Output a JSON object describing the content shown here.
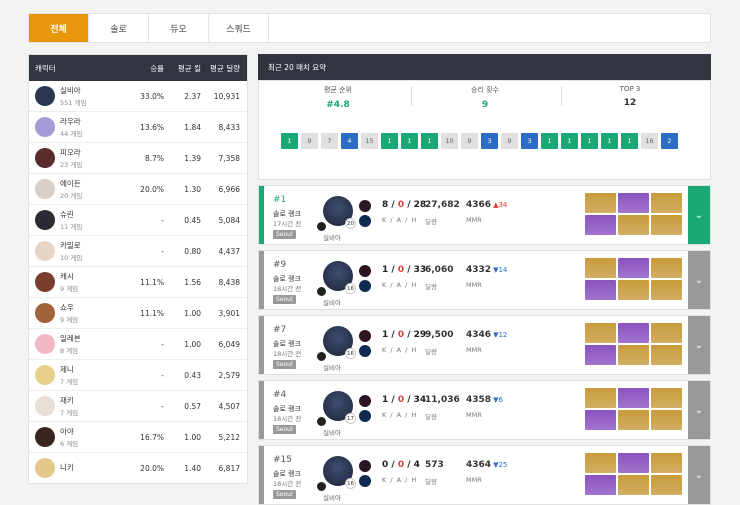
{
  "tabs": [
    {
      "label": "전체"
    },
    {
      "label": "솔로"
    },
    {
      "label": "듀오"
    },
    {
      "label": "스쿼드"
    }
  ],
  "table": {
    "headers": {
      "character": "캐릭터",
      "winrate": "승률",
      "avg_kill": "평균 킬",
      "avg_damage": "평균 딜량"
    },
    "rows": [
      {
        "name": "실비아",
        "games": "551 게임",
        "winrate": "33.0%",
        "kill": "2.37",
        "damage": "10,931",
        "color": "#2a3550"
      },
      {
        "name": "라우라",
        "games": "44 게임",
        "winrate": "13.6%",
        "kill": "1.84",
        "damage": "8,433",
        "color": "#a79ad8"
      },
      {
        "name": "피오라",
        "games": "23 게임",
        "winrate": "8.7%",
        "kill": "1.39",
        "damage": "7,358",
        "color": "#5a2b2b"
      },
      {
        "name": "에이든",
        "games": "20 게임",
        "winrate": "20.0%",
        "kill": "1.30",
        "damage": "6,966",
        "color": "#d7cfc8"
      },
      {
        "name": "슈린",
        "games": "11 게임",
        "winrate": "-",
        "kill": "0.45",
        "damage": "5,084",
        "color": "#2b2b33"
      },
      {
        "name": "카밀로",
        "games": "10 게임",
        "winrate": "-",
        "kill": "0.80",
        "damage": "4,437",
        "color": "#e6d5c3"
      },
      {
        "name": "캐시",
        "games": "9 게임",
        "winrate": "11.1%",
        "kill": "1.56",
        "damage": "8,438",
        "color": "#7a3e2c"
      },
      {
        "name": "쇼우",
        "games": "9 게임",
        "winrate": "11.1%",
        "kill": "1.00",
        "damage": "3,901",
        "color": "#a0633a"
      },
      {
        "name": "일레븐",
        "games": "8 게임",
        "winrate": "-",
        "kill": "1.00",
        "damage": "6,049",
        "color": "#f1b8c4"
      },
      {
        "name": "제니",
        "games": "7 게임",
        "winrate": "-",
        "kill": "0.43",
        "damage": "2,579",
        "color": "#e6d08a"
      },
      {
        "name": "재키",
        "games": "7 게임",
        "winrate": "-",
        "kill": "0.57",
        "damage": "4,507",
        "color": "#e8e0d6"
      },
      {
        "name": "아야",
        "games": "6 게임",
        "winrate": "16.7%",
        "kill": "1.00",
        "damage": "5,212",
        "color": "#3b2420"
      },
      {
        "name": "니키",
        "games": "",
        "winrate": "20.0%",
        "kill": "1.40",
        "damage": "6,817",
        "color": "#e6c78a"
      }
    ]
  },
  "summary": {
    "title": "최근 20 매치 요약",
    "avg_rank_label": "평균 순위",
    "avg_rank": "#4.8",
    "wins_label": "승리 횟수",
    "wins": "9",
    "top3_label": "TOP 3",
    "top3": "12",
    "chips": [
      {
        "v": "1",
        "c": "#1aa874"
      },
      {
        "v": "9",
        "c": "#e0e0e0"
      },
      {
        "v": "7",
        "c": "#e0e0e0"
      },
      {
        "v": "4",
        "c": "#2b6cc4"
      },
      {
        "v": "15",
        "c": "#e0e0e0"
      },
      {
        "v": "1",
        "c": "#1aa874"
      },
      {
        "v": "1",
        "c": "#1aa874"
      },
      {
        "v": "1",
        "c": "#1aa874"
      },
      {
        "v": "10",
        "c": "#e0e0e0"
      },
      {
        "v": "9",
        "c": "#e0e0e0"
      },
      {
        "v": "3",
        "c": "#2b6cc4"
      },
      {
        "v": "9",
        "c": "#e0e0e0"
      },
      {
        "v": "3",
        "c": "#2b6cc4"
      },
      {
        "v": "1",
        "c": "#1aa874"
      },
      {
        "v": "1",
        "c": "#1aa874"
      },
      {
        "v": "1",
        "c": "#1aa874"
      },
      {
        "v": "1",
        "c": "#1aa874"
      },
      {
        "v": "1",
        "c": "#1aa874"
      },
      {
        "v": "16",
        "c": "#e0e0e0"
      },
      {
        "v": "2",
        "c": "#2b6cc4"
      }
    ]
  },
  "matches": [
    {
      "rank": "#1",
      "mode": "솔로 랭크",
      "time": "17시간 전",
      "region": "Seoul",
      "char": "실비아",
      "level": "20",
      "k": "8",
      "d": "0",
      "a": "28",
      "kda_label": "K / A / H",
      "damage": "27,682",
      "damage_label": "딜량",
      "mmr": "4366",
      "delta": "34",
      "dir": "up",
      "mmr_label": "MMR",
      "bar": "#1aa874",
      "win": true
    },
    {
      "rank": "#9",
      "mode": "솔로 랭크",
      "time": "18시간 전",
      "region": "Seoul",
      "char": "실비아",
      "level": "16",
      "k": "1",
      "d": "0",
      "a": "33",
      "kda_label": "K / A / H",
      "damage": "6,060",
      "damage_label": "딜량",
      "mmr": "4332",
      "delta": "14",
      "dir": "down",
      "mmr_label": "MMR",
      "bar": "#999",
      "win": false
    },
    {
      "rank": "#7",
      "mode": "솔로 랭크",
      "time": "18시간 전",
      "region": "Seoul",
      "char": "실비아",
      "level": "16",
      "k": "1",
      "d": "0",
      "a": "29",
      "kda_label": "K / A / H",
      "damage": "9,500",
      "damage_label": "딜량",
      "mmr": "4346",
      "delta": "12",
      "dir": "down",
      "mmr_label": "MMR",
      "bar": "#999",
      "win": false
    },
    {
      "rank": "#4",
      "mode": "솔로 랭크",
      "time": "18시간 전",
      "region": "Seoul",
      "char": "실비아",
      "level": "17",
      "k": "1",
      "d": "0",
      "a": "34",
      "kda_label": "K / A / H",
      "damage": "11,036",
      "damage_label": "딜량",
      "mmr": "4358",
      "delta": "6",
      "dir": "down",
      "mmr_label": "MMR",
      "bar": "#999",
      "win": false
    },
    {
      "rank": "#15",
      "mode": "솔로 랭크",
      "time": "18시간 전",
      "region": "Seoul",
      "char": "실비아",
      "level": "16",
      "k": "0",
      "d": "0",
      "a": "4",
      "kda_label": "K / A / H",
      "damage": "573",
      "damage_label": "딜량",
      "mmr": "4364",
      "delta": "25",
      "dir": "down",
      "mmr_label": "MMR",
      "bar": "#999",
      "win": false
    }
  ],
  "colors": {
    "accent": "#e8960a",
    "win": "#1aa874",
    "top": "#2b6cc4",
    "dark": "#313540"
  }
}
